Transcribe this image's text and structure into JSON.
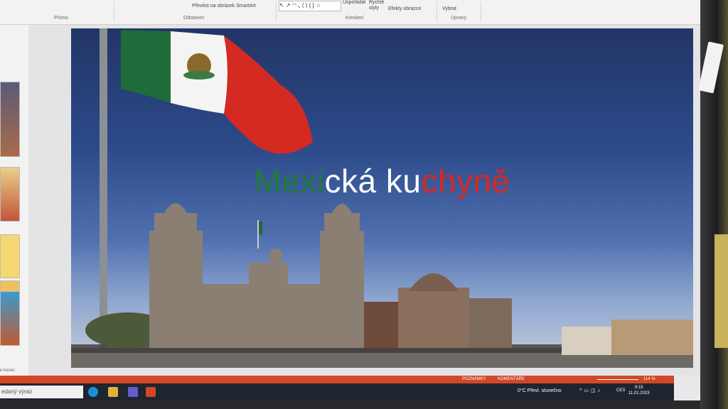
{
  "ribbon": {
    "groups": [
      "Písmo",
      "Odstavec",
      "Kreslení",
      "Úpravy"
    ],
    "buttons": {
      "convert_smartart": "Převést na obrázek SmartArt",
      "arrange": "Uspořádat",
      "quick_styles": "Rychlé styly",
      "shape_effects": "Efekty obrazce",
      "select": "Vybrat"
    }
  },
  "thumbnails": {
    "partial_label": "e konec"
  },
  "slide": {
    "title_parts": [
      {
        "text": "Mexi",
        "color": "#1f7a3c"
      },
      {
        "text": "cká k",
        "color": "#ffffff"
      },
      {
        "text": "u",
        "color": "#ffffff"
      },
      {
        "text": "chyně",
        "color": "#d42a22"
      }
    ]
  },
  "statusbar": {
    "notes": "POZNÁMKY",
    "comments": "KOMENTÁŘE",
    "zoom": "114 %"
  },
  "taskbar": {
    "search_placeholder": "edaný výraz",
    "weather": "0°C  Převl. slunečno",
    "language": "CES",
    "time": "9:15",
    "date": "11.01.2023"
  },
  "colors": {
    "accent": "#d24726",
    "flag_green": "#1f6b3a",
    "flag_red": "#d42a22"
  }
}
